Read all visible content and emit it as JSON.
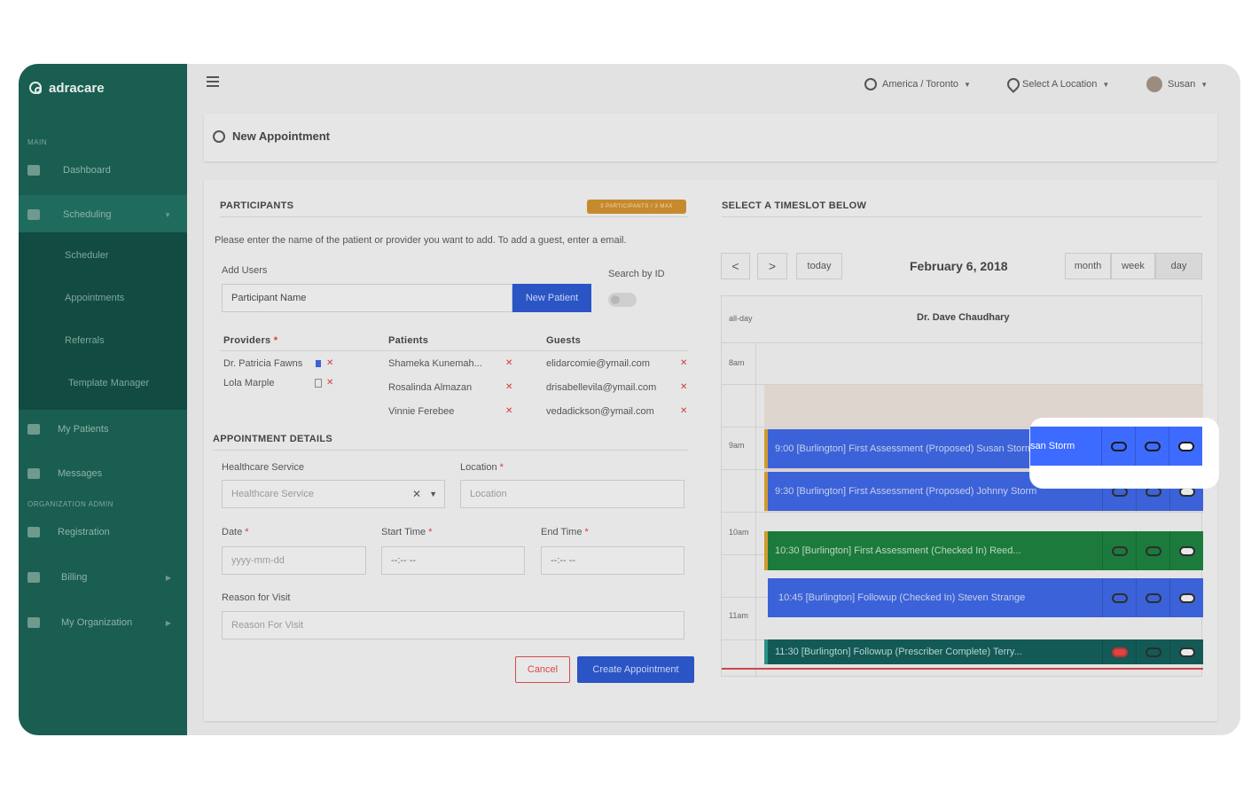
{
  "brand": {
    "name": "adracare"
  },
  "sidebar": {
    "section_main": "MAIN",
    "section_org": "ORGANIZATION ADMIN",
    "items": [
      {
        "label": "Dashboard"
      },
      {
        "label": "Scheduling"
      },
      {
        "label": "My Patients"
      },
      {
        "label": "Messages"
      },
      {
        "label": "Registration"
      },
      {
        "label": "Billing"
      },
      {
        "label": "My Organization"
      }
    ],
    "subitems": [
      {
        "label": "Scheduler"
      },
      {
        "label": "Appointments"
      },
      {
        "label": "Referrals"
      },
      {
        "label": "Template Manager"
      }
    ]
  },
  "topbar": {
    "timezone": "America / Toronto",
    "location": "Select A Location",
    "user": "Susan"
  },
  "page": {
    "title": "New Appointment"
  },
  "participants": {
    "header": "PARTICIPANTS",
    "badge": "3 PARTICIPANTS / 3 MAX",
    "instructions": "Please enter the name of the patient or provider you want to add. To add a guest, enter a email.",
    "add_users_label": "Add Users",
    "add_users_value": "Participant Name",
    "new_patient_label": "New Patient",
    "search_by_id_label": "Search by ID",
    "providers_header": "Providers",
    "patients_header": "Patients",
    "guests_header": "Guests",
    "providers": [
      "Dr. Patricia Fawns",
      "Lola Marple"
    ],
    "patients": [
      "Shameka Kunemah...",
      "Rosalinda Almazan",
      "Vinnie Ferebee"
    ],
    "guests": [
      "elidarcomie@ymail.com",
      "drisabellevila@ymail.com",
      "vedadickson@ymail.com"
    ]
  },
  "details": {
    "header": "APPOINTMENT DETAILS",
    "healthcare_label": "Healthcare Service",
    "healthcare_placeholder": "Healthcare Service",
    "location_label": "Location",
    "location_placeholder": "Location",
    "date_label": "Date",
    "date_placeholder": "yyyy-mm-dd",
    "start_label": "Start Time",
    "start_placeholder": "--:-- --",
    "end_label": "End Time",
    "end_placeholder": "--:-- --",
    "reason_label": "Reason for Visit",
    "reason_placeholder": "Reason For Visit",
    "cancel_label": "Cancel",
    "create_label": "Create Appointment"
  },
  "calendar": {
    "header": "SELECT A TIMESLOT BELOW",
    "prev": "<",
    "next": ">",
    "today": "today",
    "date": "February 6, 2018",
    "views": [
      "month",
      "week",
      "day"
    ],
    "allday_label": "all-day",
    "column": "Dr. Dave Chaudhary",
    "slots": [
      "8am",
      "9am",
      "10am",
      "11am"
    ],
    "events": [
      {
        "time": "9:00",
        "text": "9:00  [Burlington] First Assessment (Proposed) Susan Storm",
        "color": "#3b62d8"
      },
      {
        "time": "9:30",
        "text": "9:30  [Burlington] First Assessment (Proposed) Johnny Storm",
        "color": "#3b62d8"
      },
      {
        "time": "10:30",
        "text": "10:30  [Burlington] First Assessment (Checked In) Reed...",
        "color": "#1c7a3c"
      },
      {
        "time": "10:45",
        "text": "10:45  [Burlington] Followup (Checked In) Steven Strange",
        "color": "#3b62d8"
      },
      {
        "time": "11:30",
        "text": "11:30  [Burlington] Followup (Prescriber Complete) Terry...",
        "color": "#135a57"
      }
    ],
    "highlight_name": "san Storm"
  },
  "colors": {
    "sidebar": "#1a5e51",
    "primary_button": "#2b55c5",
    "event_blue": "#3b62d8",
    "event_green": "#1c7a3c",
    "event_teal": "#135a57",
    "badge": "#c68a2e"
  }
}
